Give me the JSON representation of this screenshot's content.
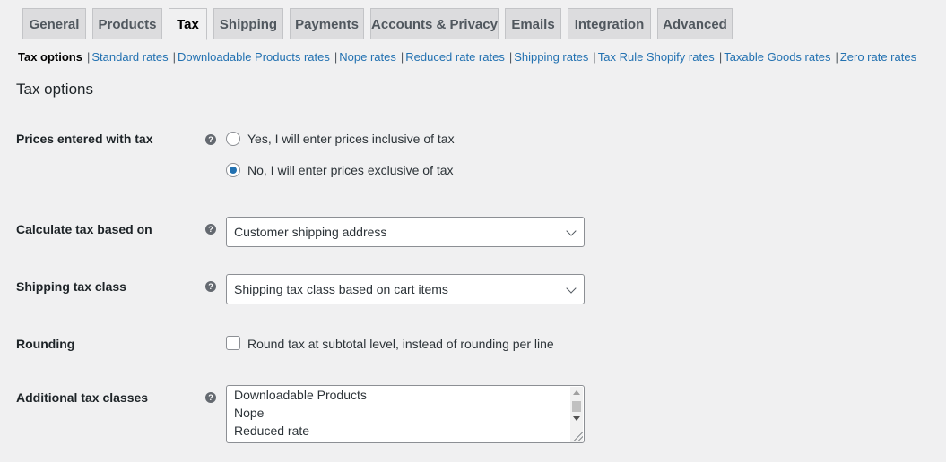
{
  "tabs": [
    {
      "label": "General"
    },
    {
      "label": "Products"
    },
    {
      "label": "Tax"
    },
    {
      "label": "Shipping"
    },
    {
      "label": "Payments"
    },
    {
      "label": "Accounts & Privacy"
    },
    {
      "label": "Emails"
    },
    {
      "label": "Integration"
    },
    {
      "label": "Advanced"
    }
  ],
  "active_tab": "Tax",
  "subnav": {
    "current": "Tax options",
    "separator": "|",
    "links": [
      "Standard rates",
      "Downloadable Products rates",
      "Nope rates",
      "Reduced rate rates",
      "Shipping rates",
      "Tax Rule Shopify rates",
      "Taxable Goods rates",
      "Zero rate rates"
    ]
  },
  "section_title": "Tax options",
  "help_glyph": "?",
  "prices_with_tax": {
    "label": "Prices entered with tax",
    "options": [
      {
        "label": "Yes, I will enter prices inclusive of tax",
        "checked": false
      },
      {
        "label": "No, I will enter prices exclusive of tax",
        "checked": true
      }
    ]
  },
  "calc_based_on": {
    "label": "Calculate tax based on",
    "selected": "Customer shipping address"
  },
  "shipping_tax_class": {
    "label": "Shipping tax class",
    "selected": "Shipping tax class based on cart items"
  },
  "rounding": {
    "label": "Rounding",
    "checkbox_label": "Round tax at subtotal level, instead of rounding per line",
    "checked": false
  },
  "additional_tax_classes": {
    "label": "Additional tax classes",
    "lines": [
      "Downloadable Products",
      "Nope",
      "Reduced rate"
    ]
  },
  "colors": {
    "link": "#2271b1",
    "background": "#f0f0f1",
    "tab_inactive": "#dcdcde",
    "radio_checked": "#2271b1"
  }
}
